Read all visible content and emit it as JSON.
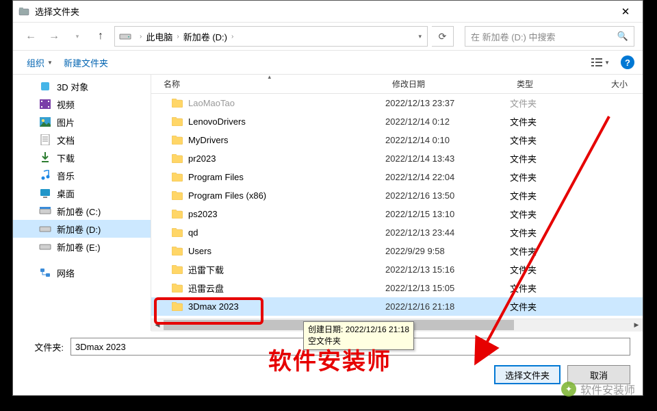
{
  "title": "选择文件夹",
  "nav": {
    "back": "←",
    "fwd": "→",
    "up": "↑"
  },
  "breadcrumb": {
    "pc": "此电脑",
    "drive": "新加卷 (D:)"
  },
  "search": {
    "placeholder": "在 新加卷 (D:) 中搜索"
  },
  "toolbar": {
    "organize": "组织",
    "newfolder": "新建文件夹"
  },
  "columns": {
    "name": "名称",
    "date": "修改日期",
    "type": "类型",
    "size": "大小"
  },
  "sidebar": {
    "items": [
      {
        "label": "3D 对象",
        "icon": "3d"
      },
      {
        "label": "视频",
        "icon": "video"
      },
      {
        "label": "图片",
        "icon": "pic"
      },
      {
        "label": "文档",
        "icon": "doc"
      },
      {
        "label": "下载",
        "icon": "dl"
      },
      {
        "label": "音乐",
        "icon": "music"
      },
      {
        "label": "桌面",
        "icon": "desk"
      },
      {
        "label": "新加卷 (C:)",
        "icon": "drive-c"
      },
      {
        "label": "新加卷 (D:)",
        "icon": "drive",
        "selected": true
      },
      {
        "label": "新加卷 (E:)",
        "icon": "drive"
      }
    ],
    "network": "网络"
  },
  "files": [
    {
      "name": "LaoMaoTao",
      "date": "2022/12/13 23:37",
      "type": "文件夹",
      "faded": true
    },
    {
      "name": "LenovoDrivers",
      "date": "2022/12/14 0:12",
      "type": "文件夹"
    },
    {
      "name": "MyDrivers",
      "date": "2022/12/14 0:10",
      "type": "文件夹"
    },
    {
      "name": "pr2023",
      "date": "2022/12/14 13:43",
      "type": "文件夹"
    },
    {
      "name": "Program Files",
      "date": "2022/12/14 22:04",
      "type": "文件夹"
    },
    {
      "name": "Program Files (x86)",
      "date": "2022/12/16 13:50",
      "type": "文件夹"
    },
    {
      "name": "ps2023",
      "date": "2022/12/15 13:10",
      "type": "文件夹"
    },
    {
      "name": "qd",
      "date": "2022/12/13 23:44",
      "type": "文件夹"
    },
    {
      "name": "Users",
      "date": "2022/9/29 9:58",
      "type": "文件夹"
    },
    {
      "name": "迅雷下载",
      "date": "2022/12/13 15:16",
      "type": "文件夹"
    },
    {
      "name": "迅雷云盘",
      "date": "2022/12/13 15:05",
      "type": "文件夹"
    },
    {
      "name": "3Dmax 2023",
      "date": "2022/12/16 21:18",
      "type": "文件夹",
      "selected": true
    }
  ],
  "tooltip": {
    "line1": "创建日期: 2022/12/16 21:18",
    "line2": "空文件夹"
  },
  "footer": {
    "label": "文件夹:",
    "value": "3Dmax 2023",
    "select": "选择文件夹",
    "cancel": "取消"
  },
  "watermark": "软件安装师",
  "wm2": "软件安装师"
}
